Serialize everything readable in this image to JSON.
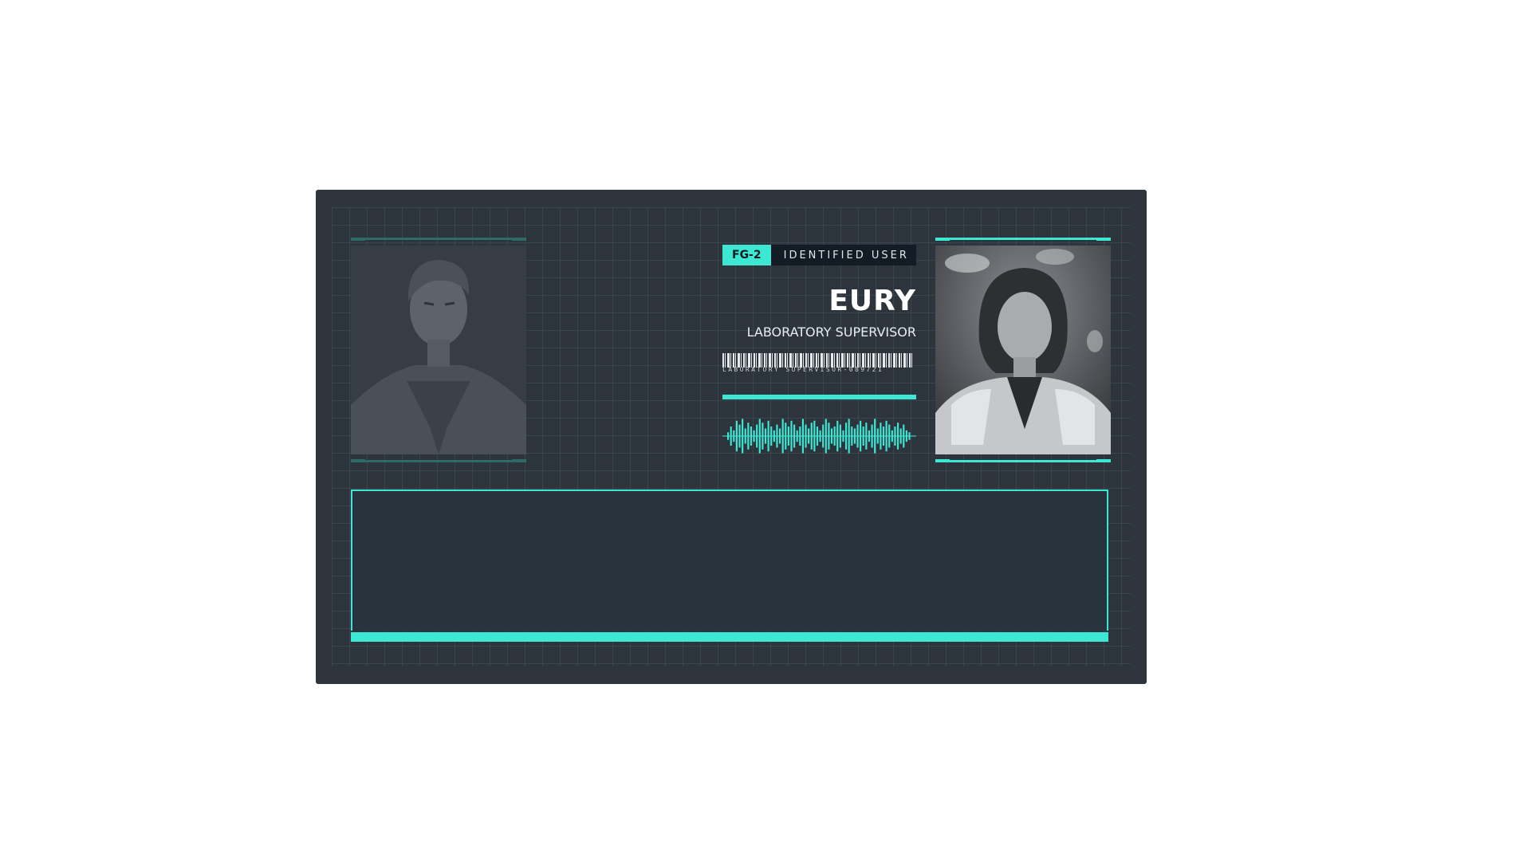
{
  "speaker": {
    "tag_code": "FG-2",
    "tag_label": "IDENTIFIED USER",
    "name": "EURY",
    "role": "LABORATORY SUPERVISOR",
    "barcode_text": "LABORATORY SUPERVISOR-089721"
  },
  "dialogue": {
    "text": ""
  },
  "colors": {
    "accent": "#3ce8d3",
    "panel": "#2f353d",
    "textbox": "#29333d"
  },
  "waveform": {
    "amplitudes": [
      0.2,
      0.5,
      0.3,
      0.8,
      0.6,
      0.9,
      0.4,
      0.7,
      0.5,
      0.3,
      0.6,
      0.9,
      0.7,
      0.4,
      0.8,
      0.5,
      0.3,
      0.6,
      0.4,
      0.9,
      0.7,
      0.5,
      0.8,
      0.6,
      0.3,
      0.5,
      0.9,
      0.6,
      0.4,
      0.7,
      0.8,
      0.5,
      0.3,
      0.6,
      0.9,
      0.7,
      0.4,
      0.5,
      0.8,
      0.6,
      0.3,
      0.7,
      0.9,
      0.5,
      0.4,
      0.6,
      0.8,
      0.5,
      0.7,
      0.3,
      0.6,
      0.9,
      0.4,
      0.7,
      0.5,
      0.8,
      0.6,
      0.3,
      0.5,
      0.7,
      0.4,
      0.6,
      0.3,
      0.2
    ]
  }
}
